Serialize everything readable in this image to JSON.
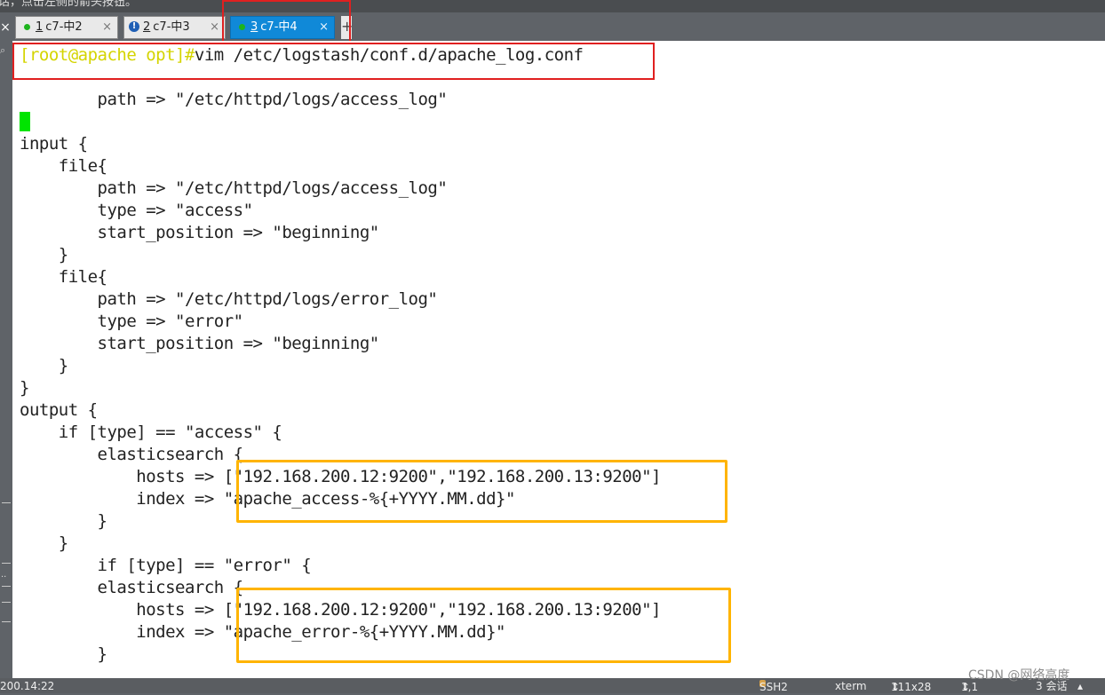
{
  "top_strip_text": "话，点击左侧的箭头按钮。",
  "tabs": [
    {
      "number": "1",
      "label": "c7-中2",
      "status": "connected"
    },
    {
      "number": "2",
      "label": "c7-中3",
      "status": "warning"
    },
    {
      "number": "3",
      "label": "c7-中4",
      "status": "connected",
      "active": true
    }
  ],
  "tab_close_glyph": "×",
  "tab_add_glyph": "+",
  "terminal": {
    "prompt": "[root@apache opt]#",
    "command": "vim /etc/logstash/conf.d/apache_log.conf",
    "lines": [
      "        path => \"/etc/httpd/logs/access_log\"",
      "",
      "input {",
      "    file{",
      "        path => \"/etc/httpd/logs/access_log\"",
      "        type => \"access\"",
      "        start_position => \"beginning\"",
      "    }",
      "    file{",
      "        path => \"/etc/httpd/logs/error_log\"",
      "        type => \"error\"",
      "        start_position => \"beginning\"",
      "    }",
      "}",
      "output {",
      "    if [type] == \"access\" {",
      "        elasticsearch {",
      "            hosts => [\"192.168.200.12:9200\",\"192.168.200.13:9200\"]",
      "            index => \"apache_access-%{+YYYY.MM.dd}\"",
      "        }",
      "    }",
      "        if [type] == \"error\" {",
      "        elasticsearch {",
      "            hosts => [\"192.168.200.12:9200\",\"192.168.200.13:9200\"]",
      "            index => \"apache_error-%{+YYYY.MM.dd}\"",
      "        }"
    ]
  },
  "status_bar": {
    "address": "200.14:22",
    "protocol": "SSH2",
    "terminal_type": "xterm",
    "size": "111x28",
    "position": "1,1",
    "sessions": "3 会话"
  },
  "watermark": "CSDN @网络高度"
}
